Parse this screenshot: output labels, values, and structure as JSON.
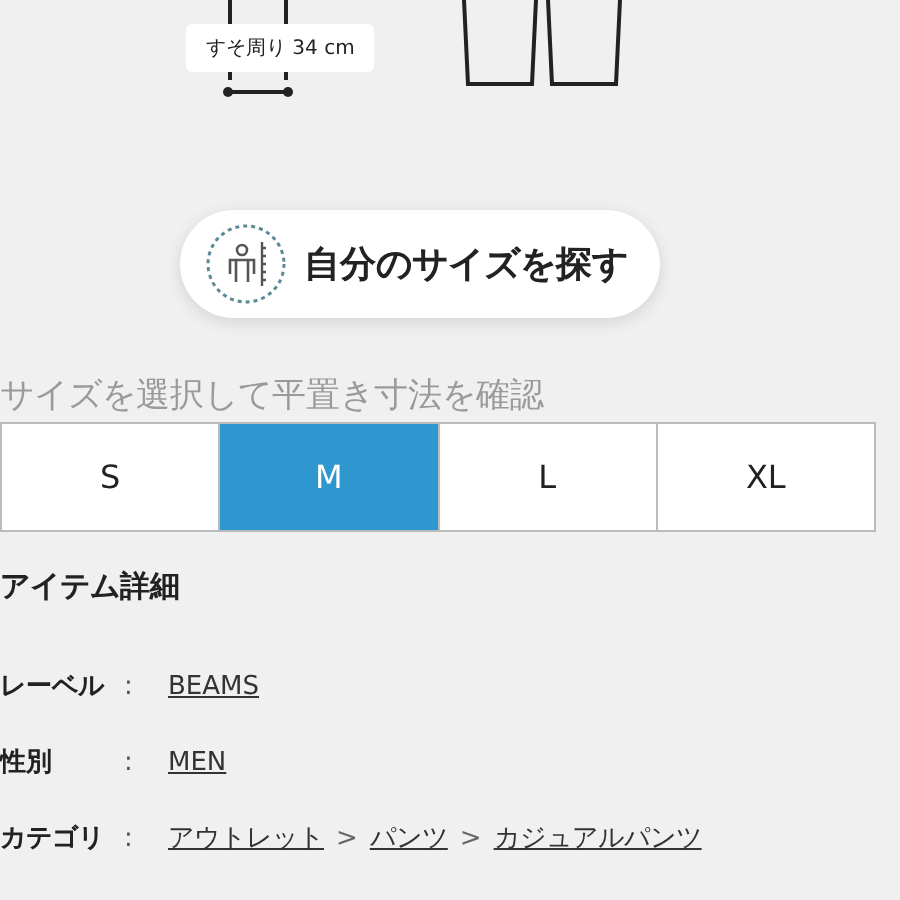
{
  "measure_label": "すそ周り 34 cm",
  "find_size_button": {
    "label": "自分のサイズを探す"
  },
  "size_section": {
    "title": "サイズを選択して平置き寸法を確認",
    "sizes": [
      {
        "label": "S",
        "selected": false
      },
      {
        "label": "M",
        "selected": true
      },
      {
        "label": "L",
        "selected": false
      },
      {
        "label": "XL",
        "selected": false
      }
    ]
  },
  "details": {
    "heading": "アイテム詳細",
    "rows": [
      {
        "label": "レーベル",
        "colon": ":",
        "parts": [
          {
            "kind": "link",
            "text": "BEAMS"
          }
        ]
      },
      {
        "label": "性別",
        "colon": ":",
        "parts": [
          {
            "kind": "link",
            "text": "MEN"
          }
        ]
      },
      {
        "label": "カテゴリ",
        "colon": ":",
        "parts": [
          {
            "kind": "link",
            "text": "アウトレット"
          },
          {
            "kind": "separator",
            "text": ">"
          },
          {
            "kind": "link",
            "text": "パンツ"
          },
          {
            "kind": "separator",
            "text": ">"
          },
          {
            "kind": "link",
            "text": "カジュアルパンツ"
          }
        ]
      }
    ]
  }
}
